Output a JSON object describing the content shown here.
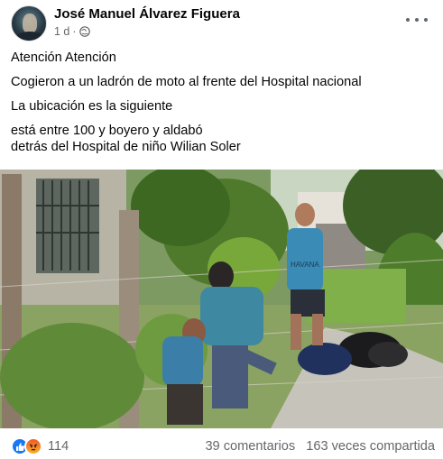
{
  "post": {
    "author": "José Manuel Álvarez Figuera",
    "time": "1 d",
    "separator": "·",
    "privacy_icon": "globe-icon",
    "more_icon": "more-horizontal-icon"
  },
  "body": {
    "lines": [
      "Atención Atención",
      "Cogieron a un ladrón de moto al frente del Hospital nacional",
      "La ubicación es la siguiente",
      "está entre 100 y boyero y aldabó",
      "detrás del Hospital de niño Wilian Soler"
    ]
  },
  "media": {
    "shirt_text": "HAVANA"
  },
  "footer": {
    "reaction_icons": [
      "like-icon",
      "angry-icon"
    ],
    "reaction_count": "114",
    "comments": "39 comentarios",
    "shares": "163 veces compartida"
  },
  "colors": {
    "text": "#050505",
    "secondary": "#65676b",
    "like": "#1877f2"
  }
}
